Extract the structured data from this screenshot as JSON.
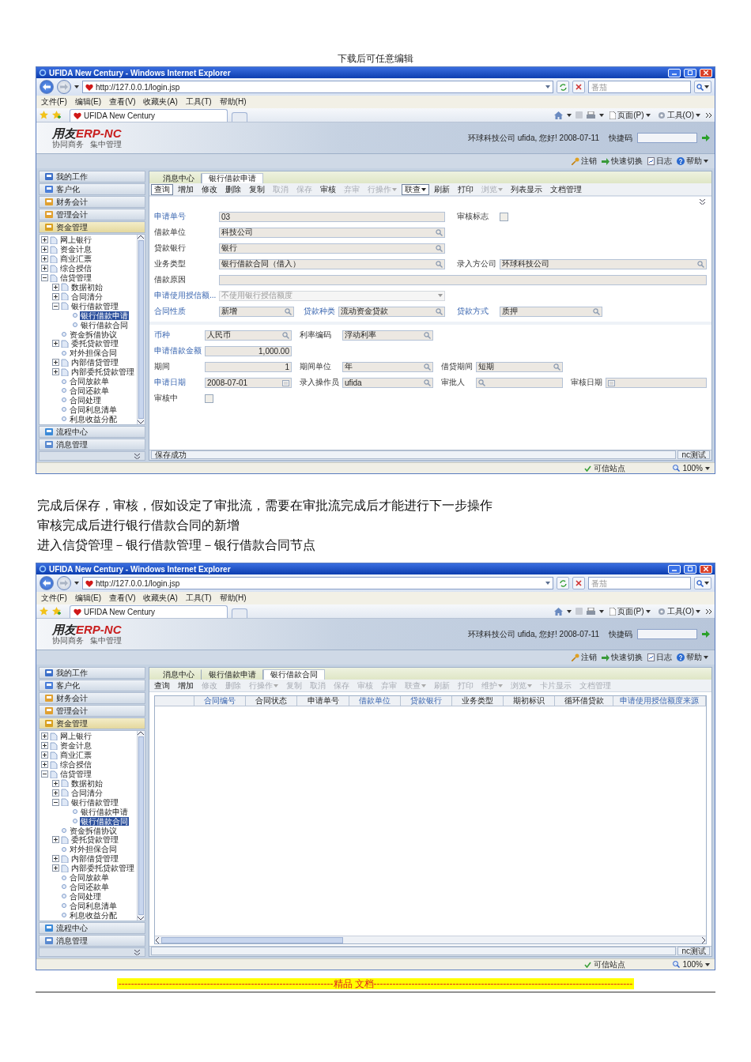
{
  "header": "下载后可任意编辑",
  "screenshot_1": {
    "window_title": "UFIDA New Century - Windows Internet Explorer",
    "address": "http://127.0.0.1/login.jsp",
    "search_placeholder": "番茄",
    "menu": [
      "文件(F)",
      "编辑(E)",
      "查看(V)",
      "收藏夹(A)",
      "工具(T)",
      "帮助(H)"
    ],
    "favorites_tab": "UFIDA New Century",
    "commands": [
      "页面(P)",
      "工具(O)"
    ],
    "app": {
      "logo": [
        "用友",
        "ERP-NC"
      ],
      "logo_tagline": [
        "协同商务",
        "集中管理"
      ],
      "greeting": "环球科技公司 ufida, 您好! 2008-07-11",
      "shortcut_label": "快捷码",
      "links": [
        "注销",
        "快速切换",
        "日志",
        "帮助"
      ],
      "categories_top": [
        {
          "label": "我的工作",
          "selected": false
        },
        {
          "label": "客户化",
          "selected": false
        },
        {
          "label": "财务会计",
          "selected": false
        },
        {
          "label": "管理会计",
          "selected": false
        },
        {
          "label": "资金管理",
          "selected": true
        }
      ],
      "tree": [
        {
          "label": "网上银行",
          "kind": "folder",
          "expanded": false,
          "selected": false
        },
        {
          "label": "资金计息",
          "kind": "folder",
          "expanded": false,
          "selected": false
        },
        {
          "label": "商业汇票",
          "kind": "folder",
          "expanded": false,
          "selected": false
        },
        {
          "label": "综合授信",
          "kind": "folder",
          "expanded": false,
          "selected": false
        },
        {
          "label": "信贷管理",
          "kind": "folder",
          "expanded": true,
          "selected": false,
          "children": [
            {
              "label": "数据初始",
              "kind": "folder",
              "expanded": false,
              "selected": false
            },
            {
              "label": "合同清分",
              "kind": "folder",
              "expanded": false,
              "selected": false
            },
            {
              "label": "银行借款管理",
              "kind": "folder",
              "expanded": true,
              "selected": false,
              "children": [
                {
                  "label": "银行借款申请",
                  "kind": "leaf",
                  "selected": true
                },
                {
                  "label": "银行借款合同",
                  "kind": "leaf",
                  "selected": false
                }
              ]
            },
            {
              "label": "资金拆借协议",
              "kind": "leaf",
              "selected": false
            },
            {
              "label": "委托贷款管理",
              "kind": "folder",
              "expanded": false,
              "selected": false
            },
            {
              "label": "对外担保合同",
              "kind": "leaf",
              "selected": false
            },
            {
              "label": "内部借贷管理",
              "kind": "folder",
              "expanded": false,
              "selected": false
            },
            {
              "label": "内部委托贷款管理",
              "kind": "folder",
              "expanded": false,
              "selected": false
            },
            {
              "label": "合同放款单",
              "kind": "leaf",
              "selected": false
            },
            {
              "label": "合同还款单",
              "kind": "leaf",
              "selected": false
            },
            {
              "label": "合同处理",
              "kind": "leaf",
              "selected": false
            },
            {
              "label": "合同利息清单",
              "kind": "leaf",
              "selected": false
            },
            {
              "label": "利息收益分配",
              "kind": "leaf",
              "selected": false
            }
          ]
        }
      ],
      "categories_bottom": [
        {
          "label": "流程中心",
          "selected": false
        },
        {
          "label": "消息管理",
          "selected": false
        }
      ],
      "tabs": [
        {
          "label": "消息中心",
          "selected": false
        },
        {
          "label": "银行借款申请",
          "selected": true
        }
      ],
      "toolbar": [
        {
          "label": "查询",
          "disabled": false,
          "pressed": true,
          "menu": false
        },
        {
          "label": "增加",
          "disabled": false,
          "pressed": false,
          "menu": false
        },
        {
          "label": "修改",
          "disabled": false,
          "pressed": false,
          "menu": false
        },
        {
          "label": "删除",
          "disabled": false,
          "pressed": false,
          "menu": false
        },
        {
          "label": "复制",
          "disabled": false,
          "pressed": false,
          "menu": false
        },
        {
          "label": "取消",
          "disabled": true,
          "pressed": false,
          "menu": false
        },
        {
          "label": "保存",
          "disabled": true,
          "pressed": false,
          "menu": false
        },
        {
          "label": "审核",
          "disabled": false,
          "pressed": false,
          "menu": false
        },
        {
          "label": "弃审",
          "disabled": true,
          "pressed": false,
          "menu": false
        },
        {
          "label": "行操作",
          "disabled": true,
          "pressed": false,
          "menu": true
        },
        {
          "label": "联查",
          "disabled": false,
          "pressed": true,
          "menu": true
        },
        {
          "label": "刷新",
          "disabled": false,
          "pressed": false,
          "menu": false
        },
        {
          "label": "打印",
          "disabled": false,
          "pressed": false,
          "menu": false
        },
        {
          "label": "浏览",
          "disabled": true,
          "pressed": false,
          "menu": true
        },
        {
          "label": "列表显示",
          "disabled": false,
          "pressed": false,
          "menu": false
        },
        {
          "label": "文档管理",
          "disabled": false,
          "pressed": false,
          "menu": false
        }
      ],
      "form": {
        "sections": [
          {
            "kind": "main",
            "rows": [
              [
                {
                  "label": "申请单号",
                  "kind": "text",
                  "value": "03",
                  "link": true,
                  "disabled": false
                },
                {
                  "label": "审核标志",
                  "kind": "check",
                  "checked": false,
                  "link": false,
                  "disabled": false
                }
              ],
              [
                {
                  "label": "借款单位",
                  "kind": "lookup",
                  "value": "科技公司",
                  "link": false,
                  "disabled": false
                }
              ],
              [
                {
                  "label": "贷款银行",
                  "kind": "lookup",
                  "value": "银行",
                  "link": false,
                  "disabled": false
                }
              ],
              [
                {
                  "label": "业务类型",
                  "kind": "lookup",
                  "value": "银行借款合同（借入）",
                  "link": false,
                  "disabled": false
                },
                {
                  "label": "录入方公司",
                  "kind": "lookup",
                  "value": "环球科技公司",
                  "link": false,
                  "disabled": false
                }
              ],
              [
                {
                  "label": "借款原因",
                  "kind": "memo",
                  "link": false,
                  "disabled": false
                }
              ],
              [
                {
                  "label": "申请使用授信额...",
                  "kind": "combo",
                  "value": "不使用银行授信额度",
                  "link": true,
                  "disabled": true
                }
              ],
              [
                {
                  "label": "合同性质",
                  "kind": "lookup",
                  "value": "新增",
                  "link": true,
                  "disabled": false
                },
                {
                  "label": "贷款种类",
                  "kind": "lookup",
                  "value": "流动资金贷款",
                  "link": true,
                  "disabled": false
                },
                {
                  "label": "贷款方式",
                  "kind": "lookup",
                  "value": "质押",
                  "link": true,
                  "disabled": false
                }
              ]
            ]
          },
          {
            "kind": "detail",
            "rows": [
              [
                {
                  "label": "币种",
                  "kind": "lookup",
                  "value": "人民币",
                  "link": true,
                  "disabled": false
                },
                {
                  "label": "利率编码",
                  "kind": "lookup",
                  "value": "浮动利率",
                  "link": false,
                  "disabled": false
                }
              ],
              [
                {
                  "label": "申请借款金额",
                  "kind": "number",
                  "value": "1,000.00",
                  "link": true,
                  "disabled": false
                }
              ],
              [
                {
                  "label": "期间",
                  "kind": "number",
                  "value": "1",
                  "link": false,
                  "disabled": false
                },
                {
                  "label": "期间单位",
                  "kind": "lookup",
                  "value": "年",
                  "link": false,
                  "disabled": false
                },
                {
                  "label": "借贷期间",
                  "kind": "lookup",
                  "value": "短期",
                  "link": false,
                  "disabled": false
                }
              ],
              [
                {
                  "label": "申请日期",
                  "kind": "date",
                  "value": "2008-07-01",
                  "link": true,
                  "disabled": false
                },
                {
                  "label": "录入操作员",
                  "kind": "lookup",
                  "value": "ufida",
                  "link": false,
                  "disabled": false
                },
                {
                  "label": "审批人",
                  "kind": "lookup",
                  "link": false,
                  "disabled": false
                },
                {
                  "label": "审核日期",
                  "kind": "date",
                  "link": false,
                  "disabled": false
                }
              ],
              [
                {
                  "label": "审核中",
                  "kind": "check",
                  "checked": false,
                  "link": false,
                  "disabled": false
                }
              ]
            ]
          }
        ]
      },
      "status_message": "保存成功",
      "status_user": "nc测试"
    },
    "ie_status": {
      "zone": "可信站点",
      "zoom": "100%"
    }
  },
  "paragraphs": [
    "完成后保存，审核，假如设定了审批流，需要在审批流完成后才能进行下一步操作",
    "审核完成后进行银行借款合同的新增",
    "进入信贷管理－银行借款管理－银行借款合同节点"
  ],
  "screenshot_2": {
    "window_title": "UFIDA New Century - Windows Internet Explorer",
    "address": "http://127.0.0.1/login.jsp",
    "search_placeholder": "番茄",
    "menu": [
      "文件(F)",
      "编辑(E)",
      "查看(V)",
      "收藏夹(A)",
      "工具(T)",
      "帮助(H)"
    ],
    "favorites_tab": "UFIDA New Century",
    "commands": [
      "页面(P)",
      "工具(O)"
    ],
    "app": {
      "logo": [
        "用友",
        "ERP-NC"
      ],
      "logo_tagline": [
        "协同商务",
        "集中管理"
      ],
      "greeting": "环球科技公司 ufida, 您好! 2008-07-11",
      "shortcut_label": "快捷码",
      "links": [
        "注销",
        "快速切换",
        "日志",
        "帮助"
      ],
      "categories_top": [
        {
          "label": "我的工作",
          "selected": false
        },
        {
          "label": "客户化",
          "selected": false
        },
        {
          "label": "财务会计",
          "selected": false
        },
        {
          "label": "管理会计",
          "selected": false
        },
        {
          "label": "资金管理",
          "selected": true
        }
      ],
      "tree": [
        {
          "label": "网上银行",
          "kind": "folder",
          "expanded": false,
          "selected": false
        },
        {
          "label": "资金计息",
          "kind": "folder",
          "expanded": false,
          "selected": false
        },
        {
          "label": "商业汇票",
          "kind": "folder",
          "expanded": false,
          "selected": false
        },
        {
          "label": "综合授信",
          "kind": "folder",
          "expanded": false,
          "selected": false
        },
        {
          "label": "信贷管理",
          "kind": "folder",
          "expanded": true,
          "selected": false,
          "children": [
            {
              "label": "数据初始",
              "kind": "folder",
              "expanded": false,
              "selected": false
            },
            {
              "label": "合同清分",
              "kind": "folder",
              "expanded": false,
              "selected": false
            },
            {
              "label": "银行借款管理",
              "kind": "folder",
              "expanded": true,
              "selected": false,
              "children": [
                {
                  "label": "银行借款申请",
                  "kind": "leaf",
                  "selected": false
                },
                {
                  "label": "银行借款合同",
                  "kind": "leaf",
                  "selected": true
                }
              ]
            },
            {
              "label": "资金拆借协议",
              "kind": "leaf",
              "selected": false
            },
            {
              "label": "委托贷款管理",
              "kind": "folder",
              "expanded": false,
              "selected": false
            },
            {
              "label": "对外担保合同",
              "kind": "leaf",
              "selected": false
            },
            {
              "label": "内部借贷管理",
              "kind": "folder",
              "expanded": false,
              "selected": false
            },
            {
              "label": "内部委托贷款管理",
              "kind": "folder",
              "expanded": false,
              "selected": false
            },
            {
              "label": "合同放款单",
              "kind": "leaf",
              "selected": false
            },
            {
              "label": "合同还款单",
              "kind": "leaf",
              "selected": false
            },
            {
              "label": "合同处理",
              "kind": "leaf",
              "selected": false
            },
            {
              "label": "合同利息清单",
              "kind": "leaf",
              "selected": false
            },
            {
              "label": "利息收益分配",
              "kind": "leaf",
              "selected": false
            }
          ]
        }
      ],
      "categories_bottom": [
        {
          "label": "流程中心",
          "selected": false
        },
        {
          "label": "消息管理",
          "selected": false
        }
      ],
      "tabs": [
        {
          "label": "消息中心",
          "selected": false
        },
        {
          "label": "银行借款申请",
          "selected": false
        },
        {
          "label": "银行借款合同",
          "selected": true
        }
      ],
      "toolbar": [
        {
          "label": "查询",
          "disabled": false,
          "pressed": false,
          "menu": false
        },
        {
          "label": "增加",
          "disabled": false,
          "pressed": false,
          "menu": false
        },
        {
          "label": "修改",
          "disabled": true,
          "pressed": false,
          "menu": false
        },
        {
          "label": "删除",
          "disabled": true,
          "pressed": false,
          "menu": false
        },
        {
          "label": "行操作",
          "disabled": true,
          "pressed": false,
          "menu": true
        },
        {
          "label": "复制",
          "disabled": true,
          "pressed": false,
          "menu": false
        },
        {
          "label": "取消",
          "disabled": true,
          "pressed": false,
          "menu": false
        },
        {
          "label": "保存",
          "disabled": true,
          "pressed": false,
          "menu": false
        },
        {
          "label": "审核",
          "disabled": true,
          "pressed": false,
          "menu": false
        },
        {
          "label": "弃审",
          "disabled": true,
          "pressed": false,
          "menu": false
        },
        {
          "label": "联查",
          "disabled": true,
          "pressed": false,
          "menu": true
        },
        {
          "label": "刷新",
          "disabled": true,
          "pressed": false,
          "menu": false
        },
        {
          "label": "打印",
          "disabled": true,
          "pressed": false,
          "menu": false
        },
        {
          "label": "维护",
          "disabled": true,
          "pressed": false,
          "menu": true
        },
        {
          "label": "浏览",
          "disabled": true,
          "pressed": false,
          "menu": true
        },
        {
          "label": "卡片显示",
          "disabled": true,
          "pressed": false,
          "menu": false
        },
        {
          "label": "文档管理",
          "disabled": true,
          "pressed": false,
          "menu": false
        }
      ],
      "table": {
        "columns": [
          {
            "label": "合同编号",
            "link": true
          },
          {
            "label": "合同状态",
            "link": false
          },
          {
            "label": "申请单号",
            "link": false
          },
          {
            "label": "借款单位",
            "link": true
          },
          {
            "label": "贷款银行",
            "link": true
          },
          {
            "label": "业务类型",
            "link": false
          },
          {
            "label": "期初标识",
            "link": false
          },
          {
            "label": "循环借贷款",
            "link": false
          },
          {
            "label": "申请使用授信额度来源",
            "link": true
          }
        ]
      },
      "status_user": "nc测试"
    },
    "ie_status": {
      "zone": "可信站点",
      "zoom": "100%"
    }
  },
  "footer": {
    "left": "--------------------------------------------------------------------",
    "label": "精品  文档",
    "right": "----------------------------------------------------------------------------------"
  }
}
